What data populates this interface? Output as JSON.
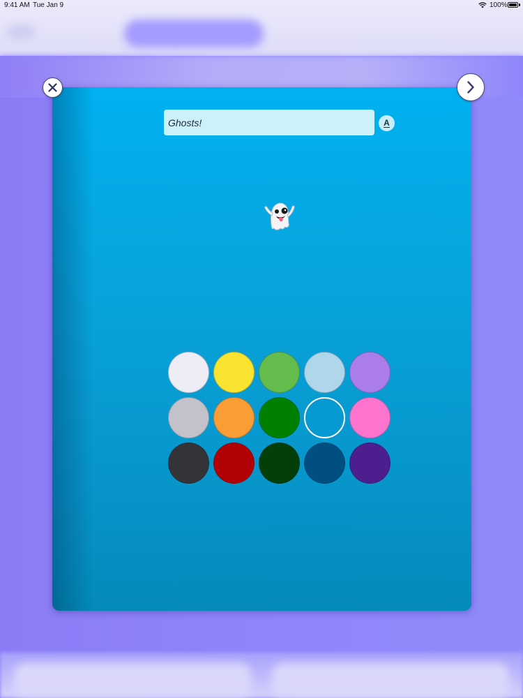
{
  "status_bar": {
    "time": "9:41 AM",
    "date": "Tue Jan 9",
    "battery": "100%"
  },
  "modal": {
    "title_value": "Ghosts!",
    "font_button_label": "A",
    "selected_emoji": "👻",
    "close_icon": "close-icon",
    "next_icon": "chevron-right-icon"
  },
  "colors": {
    "modal_top": "#00b1f0",
    "modal_bottom": "#038ab9",
    "background": "#8f86ff"
  },
  "swatches": [
    {
      "name": "white",
      "color": "#eeedf5"
    },
    {
      "name": "yellow",
      "color": "#f9e32f"
    },
    {
      "name": "green",
      "color": "#64bc4d"
    },
    {
      "name": "light-blue",
      "color": "#b0d6ea"
    },
    {
      "name": "lavender",
      "color": "#aa7de8"
    },
    {
      "name": "light-gray",
      "color": "#c3c2ca"
    },
    {
      "name": "orange",
      "color": "#fb9d35"
    },
    {
      "name": "dark-green",
      "color": "#007f01"
    },
    {
      "name": "sky-blue",
      "color": "#0799d1",
      "selected": true
    },
    {
      "name": "pink",
      "color": "#fd74cf"
    },
    {
      "name": "dark-gray",
      "color": "#333338"
    },
    {
      "name": "red",
      "color": "#b30206"
    },
    {
      "name": "forest",
      "color": "#043e08"
    },
    {
      "name": "navy",
      "color": "#014f82"
    },
    {
      "name": "purple",
      "color": "#4d1f8e"
    }
  ]
}
